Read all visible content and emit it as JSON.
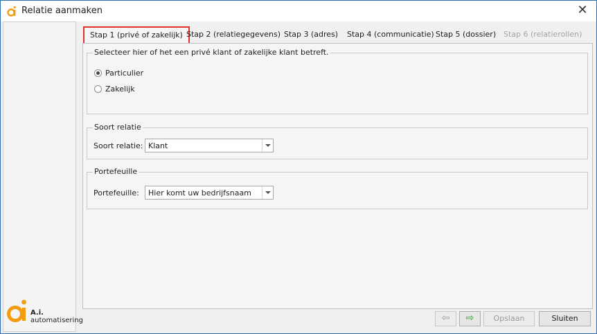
{
  "window": {
    "title": "Relatie aanmaken",
    "close_glyph": "✕"
  },
  "logo": {
    "line1": "A.i.",
    "line2": "automatisering",
    "brand_color": "#f39c12"
  },
  "tabs": [
    {
      "label": "Stap 1 (privé of zakelijk)",
      "active": true
    },
    {
      "label": "Stap 2 (relatiegegevens)"
    },
    {
      "label": "Stap 3 (adres)"
    },
    {
      "label": "Stap 4 (communicatie)"
    },
    {
      "label": "Stap 5 (dossier)"
    },
    {
      "label": "Stap 6 (relatierollen)",
      "disabled": true
    }
  ],
  "klanttype": {
    "legend": "Selecteer hier of het een privé klant of zakelijke klant betreft.",
    "options": [
      {
        "label": "Particulier",
        "checked": true
      },
      {
        "label": "Zakelijk",
        "checked": false
      }
    ]
  },
  "soort_relatie": {
    "legend": "Soort relatie",
    "label": "Soort relatie:",
    "value": "Klant"
  },
  "portefeuille": {
    "legend": "Portefeuille",
    "label": "Portefeuille:",
    "value": "Hier komt uw bedrijfsnaam"
  },
  "footer": {
    "back_icon": "arrow-left-icon",
    "back_glyph": "⇦",
    "next_icon": "arrow-right-icon",
    "next_glyph": "⇨",
    "next_color": "#2e9b2e",
    "save_label": "Opslaan",
    "close_label": "Sluiten"
  }
}
